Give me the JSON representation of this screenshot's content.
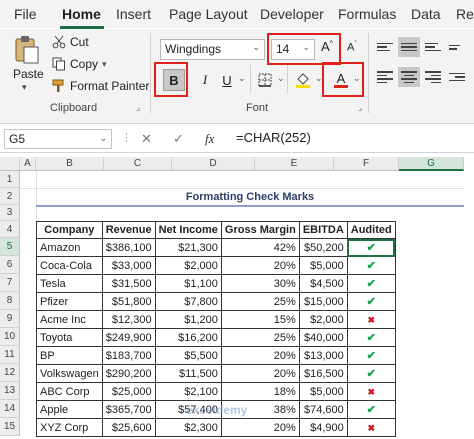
{
  "tabs": [
    "File",
    "Home",
    "Insert",
    "Page Layout",
    "Developer",
    "Formulas",
    "Data",
    "Re"
  ],
  "clipboard": {
    "paste": "Paste",
    "cut": "Cut",
    "copy": "Copy",
    "painter": "Format Painter",
    "group": "Clipboard"
  },
  "font": {
    "name": "Wingdings",
    "size": "14",
    "grow": "A",
    "shrink": "A",
    "bold": "B",
    "italic": "I",
    "underline": "U",
    "color_letter": "A",
    "group": "Font",
    "highlight": "#f5e100",
    "font_color": "#e0201c"
  },
  "formula_bar": {
    "cell": "G5",
    "cancel": "✕",
    "enter": "✓",
    "fx": "fx",
    "formula": "=CHAR(252)"
  },
  "columns": [
    "A",
    "B",
    "C",
    "D",
    "E",
    "F",
    "G"
  ],
  "rows": [
    "1",
    "2",
    "3",
    "4",
    "5",
    "6",
    "7",
    "8",
    "9",
    "10",
    "11",
    "12",
    "13",
    "14",
    "15"
  ],
  "sheet": {
    "title": "Formatting Check Marks",
    "headers": [
      "Company",
      "Revenue",
      "Net Income",
      "Gross Margin",
      "EBITDA",
      "Audited"
    ],
    "rows": [
      [
        "Amazon",
        "$386,100",
        "$21,300",
        "42%",
        "$50,200",
        "check"
      ],
      [
        "Coca-Cola",
        "$33,000",
        "$2,000",
        "20%",
        "$5,000",
        "check"
      ],
      [
        "Tesla",
        "$31,500",
        "$1,100",
        "30%",
        "$4,500",
        "check"
      ],
      [
        "Pfizer",
        "$51,800",
        "$7,800",
        "25%",
        "$15,000",
        "check"
      ],
      [
        "Acme Inc",
        "$12,300",
        "$1,200",
        "15%",
        "$2,000",
        "cross"
      ],
      [
        "Toyota",
        "$249,900",
        "$16,200",
        "25%",
        "$40,000",
        "check"
      ],
      [
        "BP",
        "$183,700",
        "$5,500",
        "20%",
        "$13,000",
        "check"
      ],
      [
        "Volkswagen",
        "$290,200",
        "$11,500",
        "20%",
        "$16,500",
        "check"
      ],
      [
        "ABC Corp",
        "$25,000",
        "$2,100",
        "18%",
        "$5,000",
        "cross"
      ],
      [
        "Apple",
        "$365,700",
        "$57,400",
        "38%",
        "$74,600",
        "check"
      ],
      [
        "XYZ Corp",
        "$25,600",
        "$2,300",
        "20%",
        "$4,900",
        "cross"
      ]
    ]
  },
  "symbols": {
    "check": "✔",
    "cross": "✖"
  },
  "watermark": "exceldemy"
}
